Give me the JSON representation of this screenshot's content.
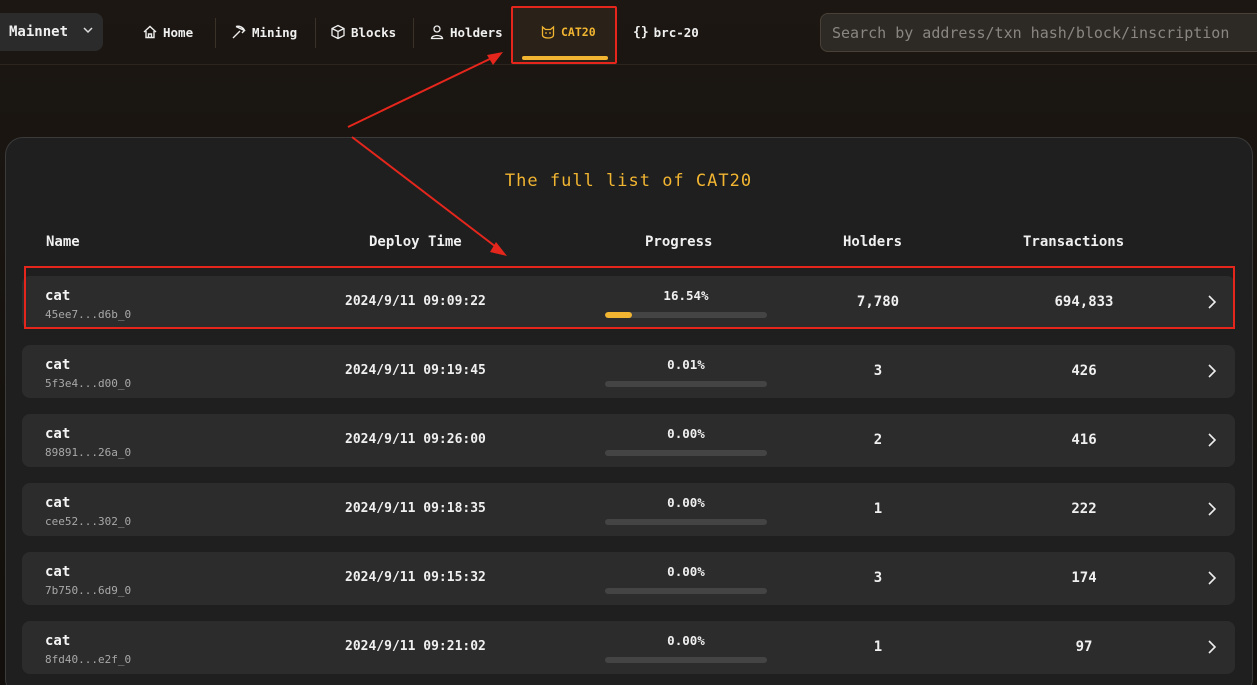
{
  "network": {
    "label": "Mainnet"
  },
  "nav": {
    "home": "Home",
    "mining": "Mining",
    "blocks": "Blocks",
    "holders": "Holders",
    "cat20": "CAT20",
    "brc20": "brc-20"
  },
  "search": {
    "placeholder": "Search by address/txn hash/block/inscription"
  },
  "main": {
    "title": "The full list of CAT20",
    "columns": {
      "name": "Name",
      "deploy_time": "Deploy Time",
      "progress": "Progress",
      "holders": "Holders",
      "transactions": "Transactions"
    },
    "rows": [
      {
        "name": "cat",
        "id": "45ee7...d6b_0",
        "deploy_time": "2024/9/11 09:09:22",
        "progress": "16.54%",
        "progress_value": 16.54,
        "holders": "7,780",
        "transactions": "694,833"
      },
      {
        "name": "cat",
        "id": "5f3e4...d00_0",
        "deploy_time": "2024/9/11 09:19:45",
        "progress": "0.01%",
        "progress_value": 0.01,
        "holders": "3",
        "transactions": "426"
      },
      {
        "name": "cat",
        "id": "89891...26a_0",
        "deploy_time": "2024/9/11 09:26:00",
        "progress": "0.00%",
        "progress_value": 0,
        "holders": "2",
        "transactions": "416"
      },
      {
        "name": "cat",
        "id": "cee52...302_0",
        "deploy_time": "2024/9/11 09:18:35",
        "progress": "0.00%",
        "progress_value": 0,
        "holders": "1",
        "transactions": "222"
      },
      {
        "name": "cat",
        "id": "7b750...6d9_0",
        "deploy_time": "2024/9/11 09:15:32",
        "progress": "0.00%",
        "progress_value": 0,
        "holders": "3",
        "transactions": "174"
      },
      {
        "name": "cat",
        "id": "8fd40...e2f_0",
        "deploy_time": "2024/9/11 09:21:02",
        "progress": "0.00%",
        "progress_value": 0,
        "holders": "1",
        "transactions": "97"
      }
    ]
  },
  "colors": {
    "accent": "#f2b531",
    "annotation": "#e5261c"
  }
}
